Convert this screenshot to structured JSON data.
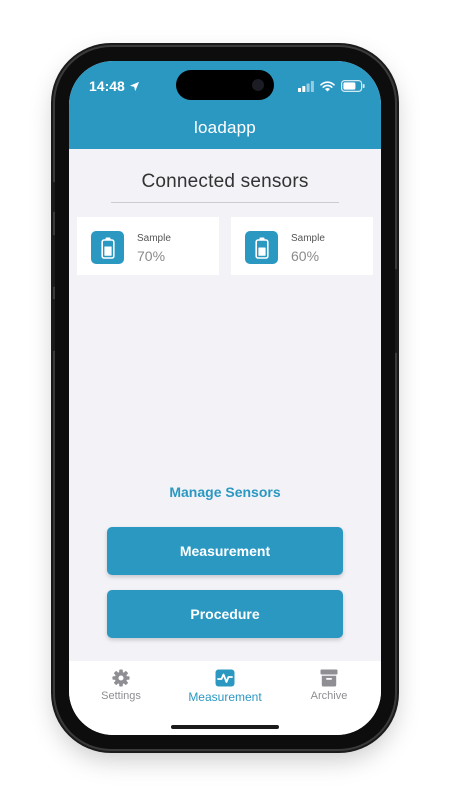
{
  "status_bar": {
    "time": "14:48"
  },
  "header": {
    "title": "loadapp"
  },
  "main": {
    "heading": "Connected sensors",
    "sensors": [
      {
        "name": "Sample",
        "battery": "70%"
      },
      {
        "name": "Sample",
        "battery": "60%"
      }
    ],
    "manage_link": "Manage Sensors",
    "buttons": {
      "measurement": "Measurement",
      "procedure": "Procedure"
    }
  },
  "tabbar": {
    "tabs": [
      {
        "label": "Settings",
        "icon": "gear-icon"
      },
      {
        "label": "Measurement",
        "icon": "waveform-icon",
        "active": true
      },
      {
        "label": "Archive",
        "icon": "archive-box-icon"
      }
    ]
  },
  "colors": {
    "accent": "#2b98c2",
    "background": "#f2f2f7",
    "card": "#ffffff"
  }
}
